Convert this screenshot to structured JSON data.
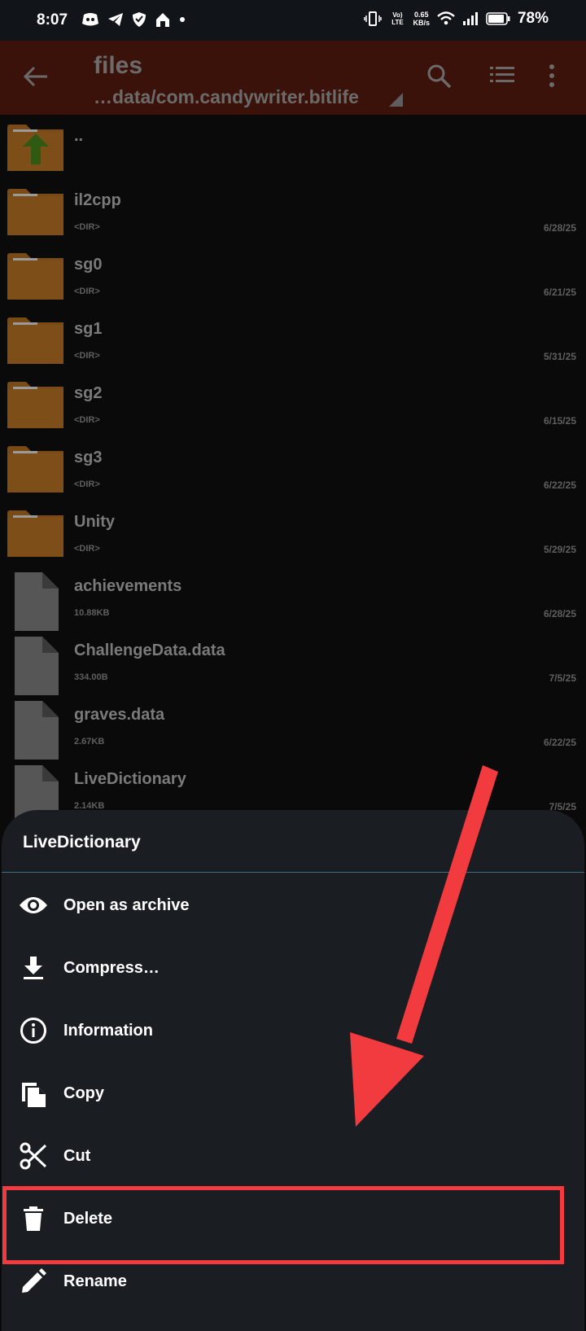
{
  "status_bar": {
    "time": "8:07",
    "volte": "Vo) LTE",
    "speed_value": "0.65",
    "speed_unit": "KB/s",
    "battery": "78%"
  },
  "toolbar": {
    "title": "files",
    "path": "…data/com.candywriter.bitlife"
  },
  "files": [
    {
      "name": "..",
      "sub": "",
      "date": "",
      "type": "up"
    },
    {
      "name": "il2cpp",
      "sub": "<DIR>",
      "date": "6/28/25",
      "type": "folder"
    },
    {
      "name": "sg0",
      "sub": "<DIR>",
      "date": "6/21/25",
      "type": "folder"
    },
    {
      "name": "sg1",
      "sub": "<DIR>",
      "date": "5/31/25",
      "type": "folder"
    },
    {
      "name": "sg2",
      "sub": "<DIR>",
      "date": "6/15/25",
      "type": "folder"
    },
    {
      "name": "sg3",
      "sub": "<DIR>",
      "date": "6/22/25",
      "type": "folder"
    },
    {
      "name": "Unity",
      "sub": "<DIR>",
      "date": "5/29/25",
      "type": "folder"
    },
    {
      "name": "achievements",
      "sub": "10.88KB",
      "date": "6/28/25",
      "type": "file"
    },
    {
      "name": "ChallengeData.data",
      "sub": "334.00B",
      "date": "7/5/25",
      "type": "file"
    },
    {
      "name": "graves.data",
      "sub": "2.67KB",
      "date": "6/22/25",
      "type": "file"
    },
    {
      "name": "LiveDictionary",
      "sub": "2.14KB",
      "date": "7/5/25",
      "type": "file"
    }
  ],
  "sheet": {
    "title": "LiveDictionary",
    "items": [
      {
        "label": "Open as archive",
        "icon": "eye-icon"
      },
      {
        "label": "Compress…",
        "icon": "download-icon"
      },
      {
        "label": "Information",
        "icon": "info-icon"
      },
      {
        "label": "Copy",
        "icon": "copy-icon"
      },
      {
        "label": "Cut",
        "icon": "scissors-icon"
      },
      {
        "label": "Delete",
        "icon": "trash-icon"
      },
      {
        "label": "Rename",
        "icon": "pencil-icon"
      }
    ]
  },
  "colors": {
    "toolbar_bg": "#3b1209",
    "sheet_bg": "#1a1d22",
    "annotation_red": "#f23b3f",
    "folder": "#7a4a14"
  }
}
